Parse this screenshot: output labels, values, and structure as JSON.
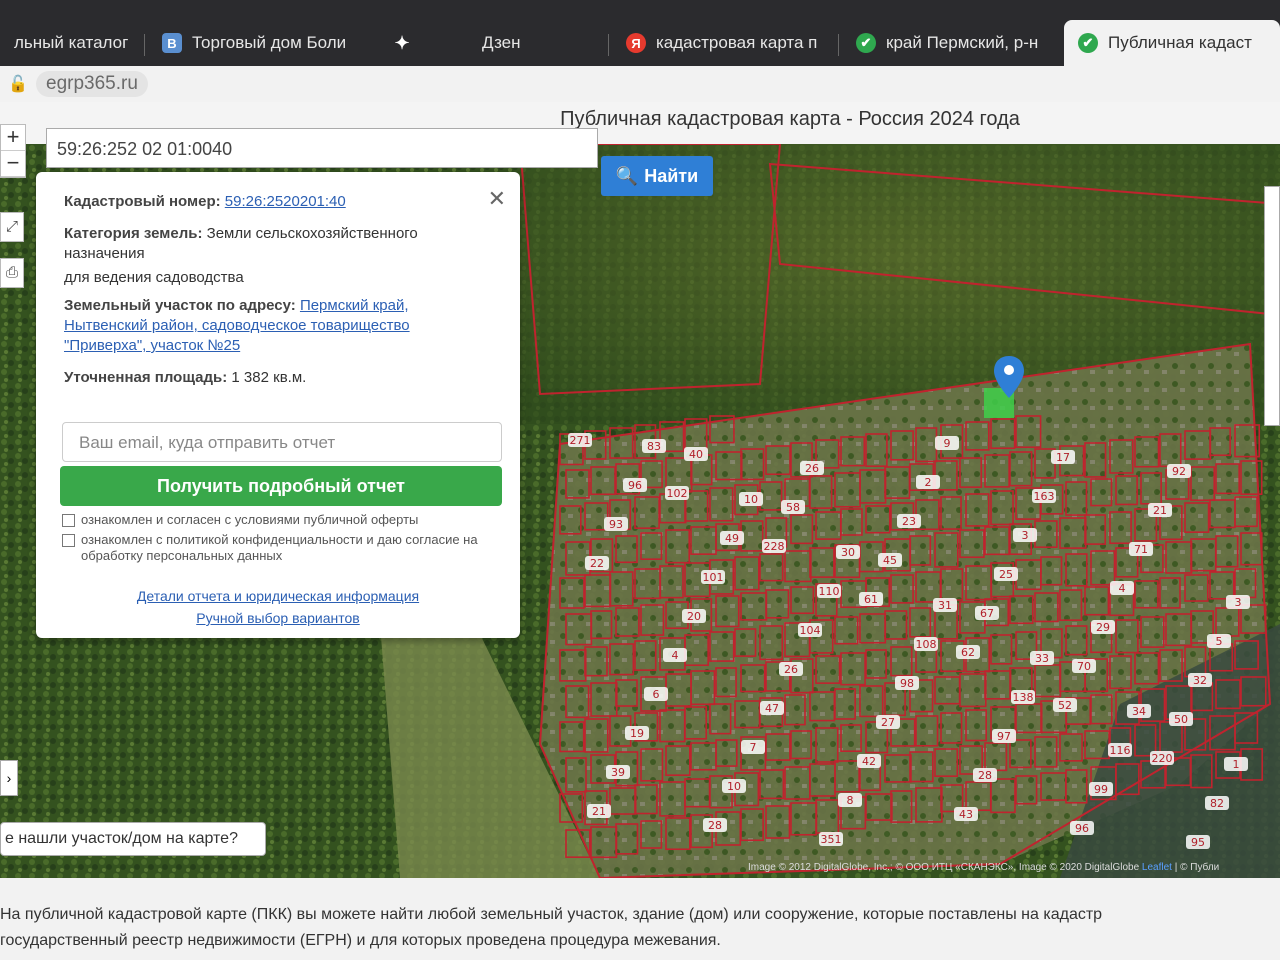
{
  "tabs": [
    {
      "label": "льный каталог",
      "icon": "generic-page-icon"
    },
    {
      "label": "Торговый дом Боли",
      "icon": "b-letter-icon",
      "icon_char": "В"
    },
    {
      "label": "",
      "icon": "sparkle-icon",
      "icon_char": "✦"
    },
    {
      "label": "Дзен",
      "icon": "none"
    },
    {
      "label": "кадастровая карта п",
      "icon": "yandex-icon",
      "icon_char": "Я"
    },
    {
      "label": "край Пермский, р-н",
      "icon": "green-check-icon",
      "icon_char": "✔"
    },
    {
      "label": "Публичная кадаст",
      "icon": "green-check-icon",
      "icon_char": "✔"
    }
  ],
  "address_bar": {
    "url": "egrp365.ru"
  },
  "page": {
    "title": "Публичная кадастровая карта - Россия 2024 года"
  },
  "search": {
    "value": "59:26:252 02 01:0040",
    "button": "Найти"
  },
  "popup": {
    "cad_label": "Кадастровый номер:",
    "cad_value": "59:26:2520201:40",
    "cat_label": "Категория земель:",
    "cat_value": "Земли сельскохозяйственного назначения",
    "use_value": "для ведения садоводства",
    "addr_label": "Земельный участок по адресу:",
    "addr_value": "Пермский край, Нытвенский район, садоводческое товарищество \"Приверха\", участок №25",
    "area_label": "Уточненная площадь:",
    "area_value": "1 382 кв.м.",
    "email_placeholder": "Ваш email, куда отправить отчет",
    "get_report": "Получить подробный отчет",
    "agree1": "ознакомлен и согласен с условиями публичной оферты",
    "agree2": "ознакомлен с политикой конфиденциальности и даю согласие на обработку персональных данных",
    "details_link": "Детали отчета и юридическая информация",
    "manual_link": "Ручной выбор вариантов"
  },
  "map": {
    "find_on_map": "е нашли участок/дом на карте?",
    "attribution_left": "Image © 2012 DigitalGlobe, Inc.; © ООО ИТЦ «СКАНЭКС», Image © 2020 DigitalGlobe",
    "attribution_leaflet": "Leaflet",
    "attribution_right": "| © Публи",
    "parcel_labels": [
      "271",
      "102",
      "228",
      "61",
      "62",
      "52",
      "220",
      "21",
      "40",
      "58",
      "45",
      "67",
      "70",
      "50",
      "39",
      "28",
      "26",
      "23",
      "25",
      "29",
      "32",
      "19",
      "10",
      "351",
      "2",
      "3",
      "4",
      "5",
      "6",
      "7",
      "8",
      "9",
      "163",
      "71",
      "3",
      "4",
      "47",
      "42",
      "43",
      "17",
      "21",
      "22",
      "20",
      "26",
      "27",
      "28",
      "96",
      "92",
      "93",
      "101",
      "104",
      "98",
      "97",
      "99",
      "95",
      "96",
      "49",
      "110",
      "108",
      "138",
      "116",
      "82",
      "83",
      "10",
      "30",
      "31",
      "33",
      "34",
      "1"
    ],
    "colors": {
      "parcel": "#c0232e",
      "pin": "#2f7fd6",
      "selected": "#3fcf4a"
    }
  },
  "footer": {
    "line1": "На публичной кадастровой карте (ПКК) вы можете найти любой земельный участок, здание (дом) или сооружение, которые поставлены на кадастр",
    "line2": "государственный реестр недвижимости (ЕГРН) и для которых проведена процедура межевания."
  }
}
